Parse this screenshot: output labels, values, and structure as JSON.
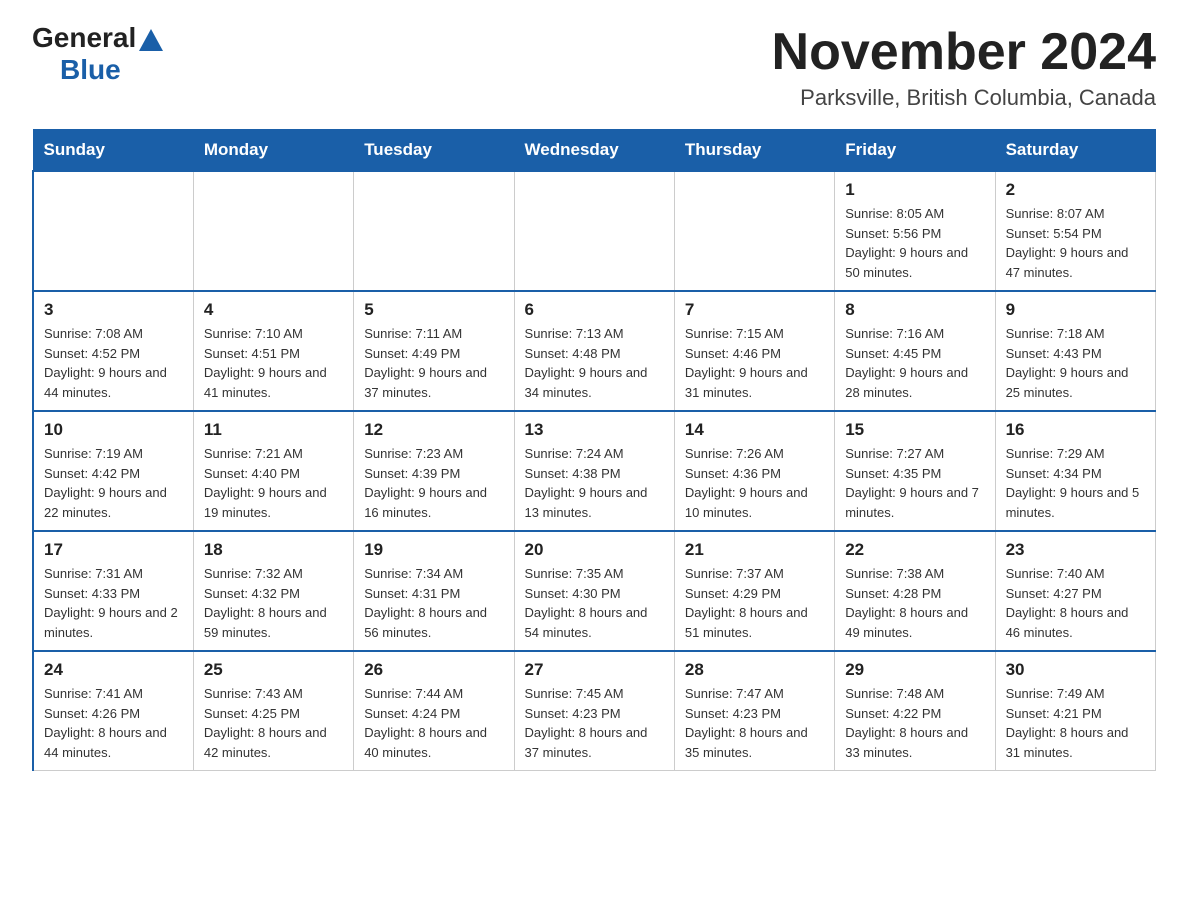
{
  "logo": {
    "general": "General",
    "blue": "Blue"
  },
  "title": "November 2024",
  "subtitle": "Parksville, British Columbia, Canada",
  "days_of_week": [
    "Sunday",
    "Monday",
    "Tuesday",
    "Wednesday",
    "Thursday",
    "Friday",
    "Saturday"
  ],
  "weeks": [
    [
      {
        "day": "",
        "info": ""
      },
      {
        "day": "",
        "info": ""
      },
      {
        "day": "",
        "info": ""
      },
      {
        "day": "",
        "info": ""
      },
      {
        "day": "",
        "info": ""
      },
      {
        "day": "1",
        "info": "Sunrise: 8:05 AM\nSunset: 5:56 PM\nDaylight: 9 hours and 50 minutes."
      },
      {
        "day": "2",
        "info": "Sunrise: 8:07 AM\nSunset: 5:54 PM\nDaylight: 9 hours and 47 minutes."
      }
    ],
    [
      {
        "day": "3",
        "info": "Sunrise: 7:08 AM\nSunset: 4:52 PM\nDaylight: 9 hours and 44 minutes."
      },
      {
        "day": "4",
        "info": "Sunrise: 7:10 AM\nSunset: 4:51 PM\nDaylight: 9 hours and 41 minutes."
      },
      {
        "day": "5",
        "info": "Sunrise: 7:11 AM\nSunset: 4:49 PM\nDaylight: 9 hours and 37 minutes."
      },
      {
        "day": "6",
        "info": "Sunrise: 7:13 AM\nSunset: 4:48 PM\nDaylight: 9 hours and 34 minutes."
      },
      {
        "day": "7",
        "info": "Sunrise: 7:15 AM\nSunset: 4:46 PM\nDaylight: 9 hours and 31 minutes."
      },
      {
        "day": "8",
        "info": "Sunrise: 7:16 AM\nSunset: 4:45 PM\nDaylight: 9 hours and 28 minutes."
      },
      {
        "day": "9",
        "info": "Sunrise: 7:18 AM\nSunset: 4:43 PM\nDaylight: 9 hours and 25 minutes."
      }
    ],
    [
      {
        "day": "10",
        "info": "Sunrise: 7:19 AM\nSunset: 4:42 PM\nDaylight: 9 hours and 22 minutes."
      },
      {
        "day": "11",
        "info": "Sunrise: 7:21 AM\nSunset: 4:40 PM\nDaylight: 9 hours and 19 minutes."
      },
      {
        "day": "12",
        "info": "Sunrise: 7:23 AM\nSunset: 4:39 PM\nDaylight: 9 hours and 16 minutes."
      },
      {
        "day": "13",
        "info": "Sunrise: 7:24 AM\nSunset: 4:38 PM\nDaylight: 9 hours and 13 minutes."
      },
      {
        "day": "14",
        "info": "Sunrise: 7:26 AM\nSunset: 4:36 PM\nDaylight: 9 hours and 10 minutes."
      },
      {
        "day": "15",
        "info": "Sunrise: 7:27 AM\nSunset: 4:35 PM\nDaylight: 9 hours and 7 minutes."
      },
      {
        "day": "16",
        "info": "Sunrise: 7:29 AM\nSunset: 4:34 PM\nDaylight: 9 hours and 5 minutes."
      }
    ],
    [
      {
        "day": "17",
        "info": "Sunrise: 7:31 AM\nSunset: 4:33 PM\nDaylight: 9 hours and 2 minutes."
      },
      {
        "day": "18",
        "info": "Sunrise: 7:32 AM\nSunset: 4:32 PM\nDaylight: 8 hours and 59 minutes."
      },
      {
        "day": "19",
        "info": "Sunrise: 7:34 AM\nSunset: 4:31 PM\nDaylight: 8 hours and 56 minutes."
      },
      {
        "day": "20",
        "info": "Sunrise: 7:35 AM\nSunset: 4:30 PM\nDaylight: 8 hours and 54 minutes."
      },
      {
        "day": "21",
        "info": "Sunrise: 7:37 AM\nSunset: 4:29 PM\nDaylight: 8 hours and 51 minutes."
      },
      {
        "day": "22",
        "info": "Sunrise: 7:38 AM\nSunset: 4:28 PM\nDaylight: 8 hours and 49 minutes."
      },
      {
        "day": "23",
        "info": "Sunrise: 7:40 AM\nSunset: 4:27 PM\nDaylight: 8 hours and 46 minutes."
      }
    ],
    [
      {
        "day": "24",
        "info": "Sunrise: 7:41 AM\nSunset: 4:26 PM\nDaylight: 8 hours and 44 minutes."
      },
      {
        "day": "25",
        "info": "Sunrise: 7:43 AM\nSunset: 4:25 PM\nDaylight: 8 hours and 42 minutes."
      },
      {
        "day": "26",
        "info": "Sunrise: 7:44 AM\nSunset: 4:24 PM\nDaylight: 8 hours and 40 minutes."
      },
      {
        "day": "27",
        "info": "Sunrise: 7:45 AM\nSunset: 4:23 PM\nDaylight: 8 hours and 37 minutes."
      },
      {
        "day": "28",
        "info": "Sunrise: 7:47 AM\nSunset: 4:23 PM\nDaylight: 8 hours and 35 minutes."
      },
      {
        "day": "29",
        "info": "Sunrise: 7:48 AM\nSunset: 4:22 PM\nDaylight: 8 hours and 33 minutes."
      },
      {
        "day": "30",
        "info": "Sunrise: 7:49 AM\nSunset: 4:21 PM\nDaylight: 8 hours and 31 minutes."
      }
    ]
  ]
}
